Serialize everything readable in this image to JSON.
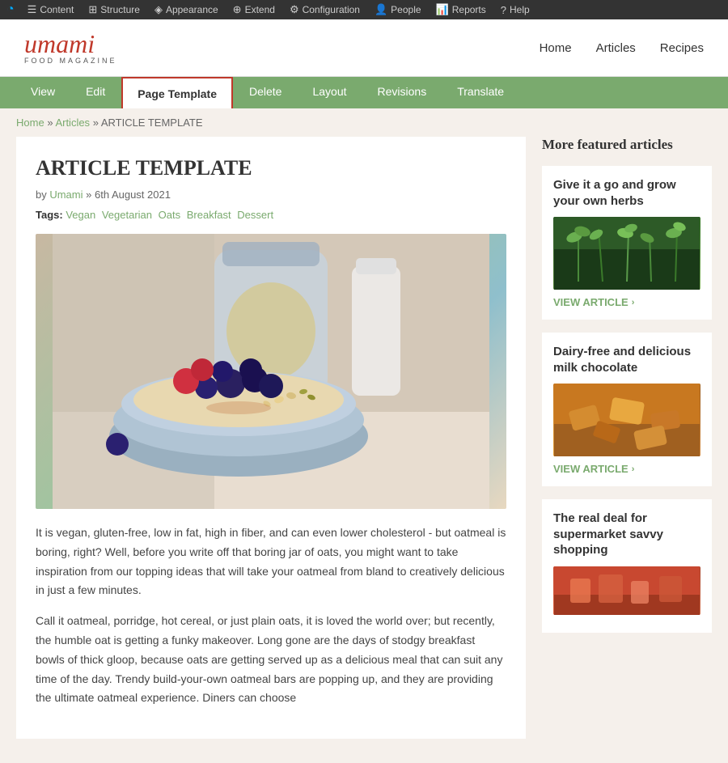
{
  "admin_toolbar": {
    "items": [
      {
        "id": "content",
        "label": "Content",
        "icon": "☰"
      },
      {
        "id": "structure",
        "label": "Structure",
        "icon": "⊞"
      },
      {
        "id": "appearance",
        "label": "Appearance",
        "icon": "◈"
      },
      {
        "id": "extend",
        "label": "Extend",
        "icon": "⊕"
      },
      {
        "id": "configuration",
        "label": "Configuration",
        "icon": "⚙"
      },
      {
        "id": "people",
        "label": "People",
        "icon": "👤"
      },
      {
        "id": "reports",
        "label": "Reports",
        "icon": "📊"
      },
      {
        "id": "help",
        "label": "Help",
        "icon": "?"
      }
    ]
  },
  "site": {
    "logo": "umami",
    "tagline": "FOOD MAGAZINE"
  },
  "main_nav": {
    "items": [
      {
        "label": "Home"
      },
      {
        "label": "Articles"
      },
      {
        "label": "Recipes"
      }
    ]
  },
  "tabs": {
    "items": [
      {
        "id": "view",
        "label": "View",
        "active": false
      },
      {
        "id": "edit",
        "label": "Edit",
        "active": false
      },
      {
        "id": "page-template",
        "label": "Page Template",
        "active": true
      },
      {
        "id": "delete",
        "label": "Delete",
        "active": false
      },
      {
        "id": "layout",
        "label": "Layout",
        "active": false
      },
      {
        "id": "revisions",
        "label": "Revisions",
        "active": false
      },
      {
        "id": "translate",
        "label": "Translate",
        "active": false
      }
    ]
  },
  "breadcrumb": {
    "home": "Home",
    "articles": "Articles",
    "current": "ARTICLE TEMPLATE"
  },
  "article": {
    "title": "ARTICLE TEMPLATE",
    "author": "Umami",
    "date": "6th August 2021",
    "tags_label": "Tags:",
    "tags": [
      "Vegan",
      "Vegetarian",
      "Oats",
      "Breakfast",
      "Dessert"
    ],
    "body_para1": "It is vegan, gluten-free, low in fat, high in fiber, and can even lower cholesterol - but oatmeal is boring, right? Well, before you write off that boring jar of oats, you might want to take inspiration from our topping ideas that will take your oatmeal from bland to creatively delicious in just a few minutes.",
    "body_para2": "Call it oatmeal, porridge, hot cereal, or just plain oats, it is loved the world over; but recently, the humble oat is getting a funky makeover. Long gone are the days of stodgy breakfast bowls of thick gloop, because oats are getting served up as a delicious meal that can suit any time of the day. Trendy build-your-own oatmeal bars are popping up, and they are providing the ultimate oatmeal experience. Diners can choose"
  },
  "sidebar": {
    "title": "More featured articles",
    "cards": [
      {
        "id": "herbs",
        "title": "Give it a go and grow your own herbs",
        "img_class": "img-herbs",
        "link_text": "VIEW ARTICLE"
      },
      {
        "id": "chocolate",
        "title": "Dairy-free and delicious milk chocolate",
        "img_class": "img-chocolate",
        "link_text": "VIEW ARTICLE"
      },
      {
        "id": "shopping",
        "title": "The real deal for supermarket savvy shopping",
        "img_class": "img-shopping",
        "link_text": ""
      }
    ]
  }
}
